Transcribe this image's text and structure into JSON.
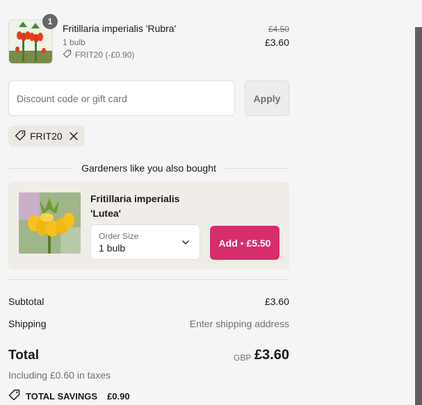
{
  "cart_item": {
    "quantity": "1",
    "name": "Fritillaria imperialis 'Rubra'",
    "variant": "1 bulb",
    "discount": "FRIT20 (-£0.90)",
    "original_price": "£4.50",
    "price": "£3.60"
  },
  "discount": {
    "placeholder": "Discount code or gift card",
    "value": "",
    "apply_label": "Apply",
    "applied_code": "FRIT20"
  },
  "upsell": {
    "heading": "Gardeners like you also bought",
    "product_name": "Fritillaria imperialis 'Lutea'",
    "size_label": "Order Size",
    "size_value": "1 bulb",
    "add_label": "Add • £5.50"
  },
  "summary": {
    "subtotal_label": "Subtotal",
    "subtotal_value": "£3.60",
    "shipping_label": "Shipping",
    "shipping_value": "Enter shipping address",
    "total_label": "Total",
    "currency": "GBP",
    "total_value": "£3.60",
    "taxes_note": "Including £0.60 in taxes",
    "savings_label": "TOTAL SAVINGS",
    "savings_value": "£0.90"
  },
  "colors": {
    "accent": "#d62e6c",
    "chip_bg": "#ece9e4",
    "card_bg": "#f0ede8"
  },
  "icons": [
    "tag-icon",
    "close-icon",
    "chevron-down-icon",
    "discount-tag-icon"
  ]
}
